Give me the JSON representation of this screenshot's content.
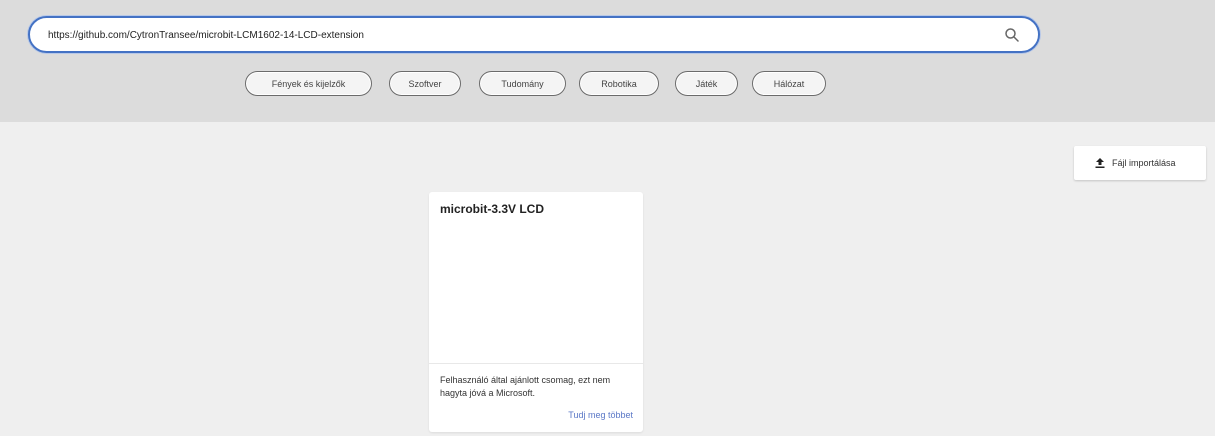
{
  "search": {
    "value": "https://github.com/CytronTransee/microbit-LCM1602-14-LCD-extension"
  },
  "categories": [
    {
      "label": "Fények és kijelzők"
    },
    {
      "label": "Szoftver"
    },
    {
      "label": "Tudomány"
    },
    {
      "label": "Robotika"
    },
    {
      "label": "Játék"
    },
    {
      "label": "Hálózat"
    }
  ],
  "import_button": {
    "label": "Fájl importálása",
    "icon": "upload-icon"
  },
  "results": [
    {
      "title": "microbit-3.3V LCD",
      "warning": "Felhasználó által ajánlott csomag, ezt nem hagyta jóvá a Microsoft.",
      "link": "Tudj meg többet"
    }
  ],
  "colors": {
    "accent": "#4472c4",
    "link": "#5b78c7"
  }
}
